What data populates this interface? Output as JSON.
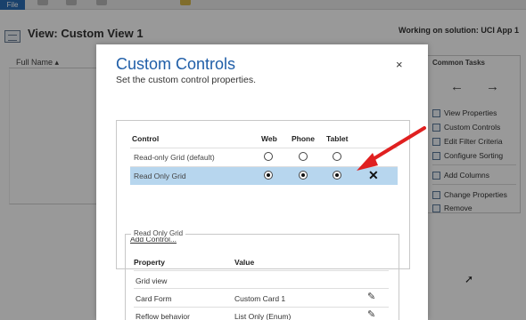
{
  "app": {
    "file_tab": "File",
    "view_title": "View: Custom View 1",
    "solution": "Working on solution: UCI App 1",
    "grid_column": "Full Name"
  },
  "common_tasks": {
    "title": "Common Tasks",
    "items": [
      {
        "label": "View Properties",
        "icon": "properties-icon"
      },
      {
        "label": "Custom Controls",
        "icon": "custom-controls-icon"
      },
      {
        "label": "Edit Filter Criteria",
        "icon": "filter-icon"
      },
      {
        "label": "Configure Sorting",
        "icon": "sort-icon"
      },
      {
        "label": "Add Columns",
        "icon": "add-columns-icon"
      },
      {
        "label": "Change Properties",
        "icon": "change-properties-icon"
      },
      {
        "label": "Remove",
        "icon": "remove-icon"
      }
    ]
  },
  "dialog": {
    "title": "Custom Controls",
    "subtitle": "Set the custom control properties.",
    "close_glyph": "×",
    "headers": {
      "control": "Control",
      "web": "Web",
      "phone": "Phone",
      "tablet": "Tablet"
    },
    "controls": [
      {
        "name": "Read-only Grid (default)",
        "web": false,
        "phone": false,
        "tablet": false,
        "selected": false
      },
      {
        "name": "Read Only Grid",
        "web": true,
        "phone": true,
        "tablet": true,
        "selected": true
      }
    ],
    "remove_glyph": "✕",
    "add_control": "Add Control...",
    "properties": {
      "legend": "Read Only Grid",
      "headers": {
        "property": "Property",
        "value": "Value"
      },
      "rows": [
        {
          "property": "Grid view",
          "value": "",
          "editable": false
        },
        {
          "property": "Card Form",
          "value": "Custom Card 1",
          "editable": true
        },
        {
          "property": "Reflow behavior",
          "value": "List Only (Enum)",
          "editable": true
        }
      ]
    }
  },
  "colors": {
    "accent": "#1f5ea8",
    "selected_row": "#b7d6ee",
    "annotation_arrow": "#e02020"
  }
}
